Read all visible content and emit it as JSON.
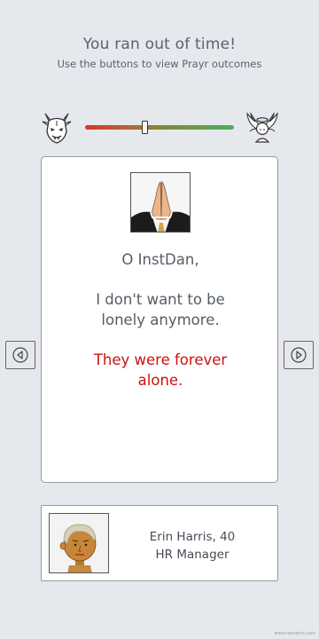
{
  "header": {
    "title": "You ran out of time!",
    "subtitle": "Use the buttons to view Prayr outcomes"
  },
  "slider": {
    "value_fraction": 0.4,
    "left_icon": "demon-icon",
    "right_icon": "angel-icon",
    "gradient_colors": [
      "#d23a2a",
      "#4caf5a"
    ]
  },
  "prayer": {
    "image_icon": "praying-hands-icon",
    "salutation": "O InstDan,",
    "body": "I don't want to be lonely anymore.",
    "outcome": "They were forever alone.",
    "outcome_color": "#cc1111"
  },
  "navigation": {
    "prev_icon": "chevron-left-icon",
    "next_icon": "chevron-right-icon"
  },
  "profile": {
    "name_age": "Erin Harris, 40",
    "job": "HR Manager",
    "avatar_icon": "avatar-icon"
  },
  "watermark": "www.nemerin.com"
}
